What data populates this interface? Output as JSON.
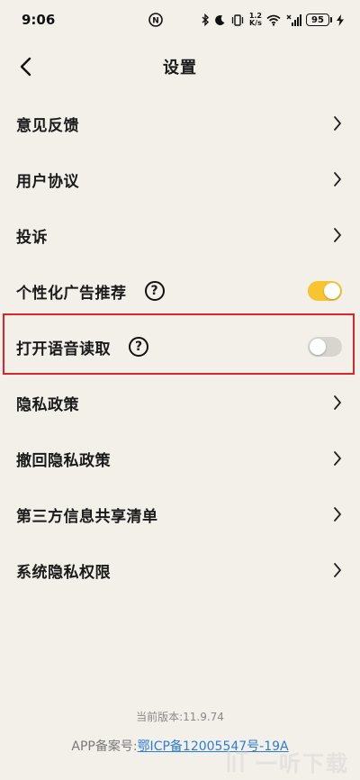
{
  "status_bar": {
    "time": "9:06",
    "net_speed_value": "1.2",
    "net_speed_unit": "K/s",
    "battery": "95",
    "icons": [
      "sync-icon",
      "bluetooth-icon",
      "moon-icon",
      "vibrate-icon",
      "wifi-icon",
      "signal-icon",
      "battery-icon",
      "charging-icon"
    ]
  },
  "header": {
    "title": "设置"
  },
  "settings": {
    "items": [
      {
        "label": "意见反馈",
        "type": "link"
      },
      {
        "label": "用户协议",
        "type": "link"
      },
      {
        "label": "投诉",
        "type": "link"
      },
      {
        "label": "个性化广告推荐",
        "type": "toggle",
        "help": "?",
        "state": "on"
      },
      {
        "label": "打开语音读取",
        "type": "toggle",
        "help": "?",
        "state": "off"
      },
      {
        "label": "隐私政策",
        "type": "link"
      },
      {
        "label": "撤回隐私政策",
        "type": "link"
      },
      {
        "label": "第三方信息共享清单",
        "type": "link"
      },
      {
        "label": "系统隐私权限",
        "type": "link"
      }
    ]
  },
  "footer": {
    "version": "当前版本:11.9.74",
    "icp_prefix": "APP备案号:",
    "icp_link": "鄂ICP备12005547号-19A"
  },
  "watermark": {
    "text": "一听下载"
  },
  "colors": {
    "background": "#f3efe9",
    "toggle_on": "#f7c531",
    "toggle_off": "#d8d4cf",
    "highlight": "#d8262b",
    "link": "#2b7ed8"
  }
}
